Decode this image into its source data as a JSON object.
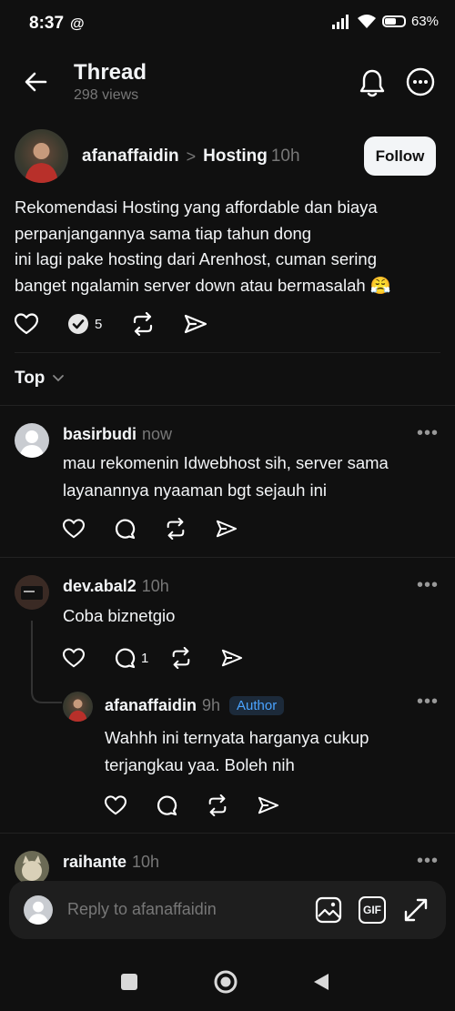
{
  "status": {
    "time": "8:37",
    "app_glyph": "@",
    "battery": "63%",
    "battery_level": 0.63
  },
  "header": {
    "title": "Thread",
    "views": "298 views"
  },
  "post": {
    "username": "afanaffaidin",
    "separator": ">",
    "topic": "Hosting",
    "time": "10h",
    "follow_label": "Follow",
    "lines": [
      "Rekomendasi Hosting yang affordable dan biaya",
      "perpanjangannya sama tiap tahun dong",
      "ini lagi pake hosting dari Arenhost, cuman sering",
      "banget ngalamin server down atau bermasalah 😤"
    ],
    "reply_count": "5"
  },
  "sort": {
    "label": "Top"
  },
  "comments": [
    {
      "username": "basirbudi",
      "time": "now",
      "lines": [
        "mau rekomenin Idwebhost sih, server sama",
        "layanannya nyaaman bgt sejauh ini"
      ],
      "reply_count": ""
    },
    {
      "username": "dev.abal2",
      "time": "10h",
      "lines": [
        "Coba biznetgio"
      ],
      "reply_count": "1"
    },
    {
      "username": "afanaffaidin",
      "time": "9h",
      "badge": "Author",
      "lines": [
        "Wahhh ini ternyata harganya cukup",
        "terjangkau yaa. Boleh nih"
      ],
      "reply_count": ""
    },
    {
      "username": "raihante",
      "time": "10h"
    }
  ],
  "more_glyph": "•••",
  "reply_bar": {
    "placeholder": "Reply to afanaffaidin",
    "gif_label": "GIF"
  }
}
